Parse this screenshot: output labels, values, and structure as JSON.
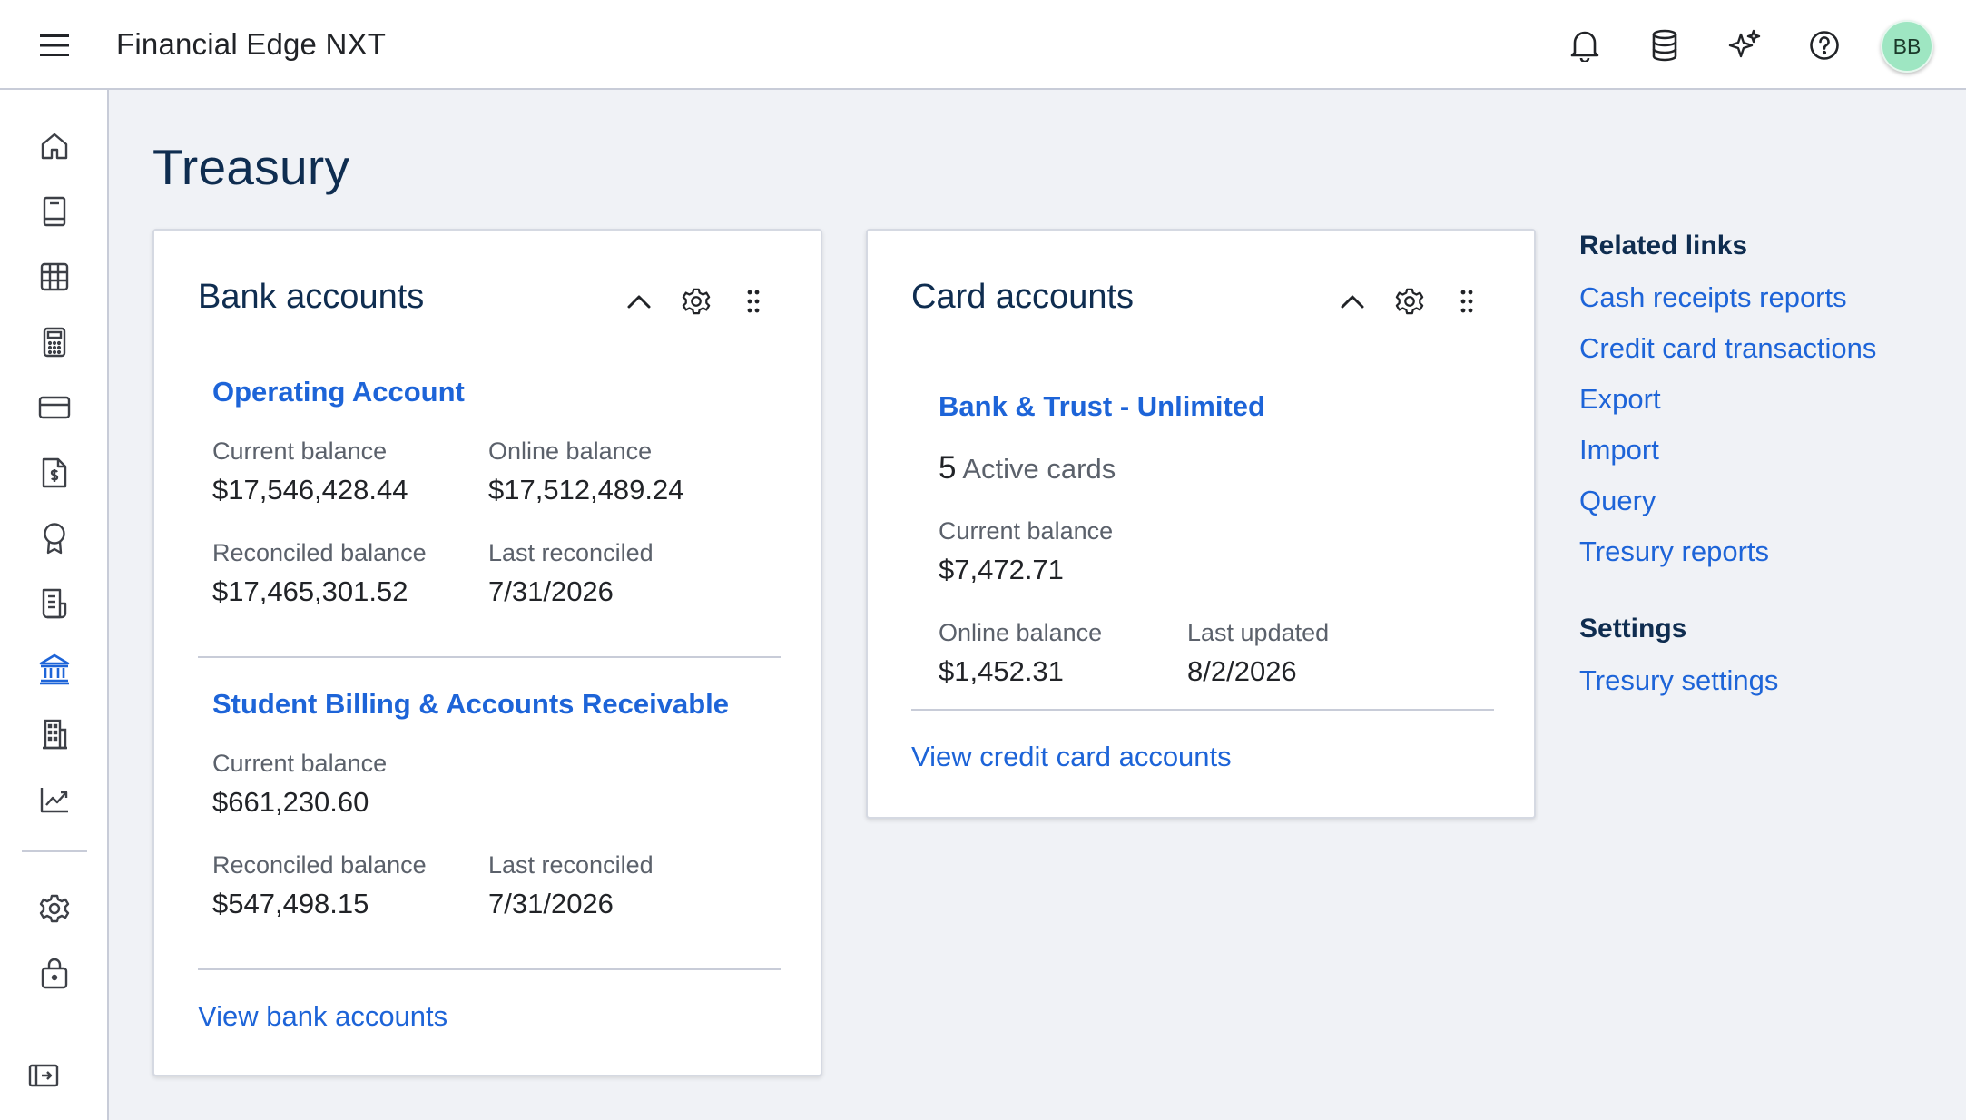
{
  "header": {
    "app_title": "Financial Edge NXT",
    "avatar_initials": "BB",
    "avatar_color": "#9ee6c2",
    "icons": [
      "hamburger-menu-icon",
      "bell-icon",
      "database-icon",
      "sparkle-icon",
      "help-icon"
    ]
  },
  "sidenav": {
    "items": [
      "home-icon",
      "book-icon",
      "grid-table-icon",
      "calculator-icon",
      "credit-card-icon",
      "document-dollar-icon",
      "award-ribbon-icon",
      "receipt-icon",
      "bank-icon",
      "building-icon",
      "trend-chart-icon",
      "gear-icon",
      "lock-briefcase-icon",
      "collapse-panel-icon"
    ],
    "active": "bank-icon"
  },
  "page": {
    "title": "Treasury"
  },
  "bank_accounts": {
    "title": "Bank accounts",
    "accounts": [
      {
        "name": "Operating Account",
        "current_balance_label": "Current balance",
        "current_balance": "$17,546,428.44",
        "online_balance_label": "Online balance",
        "online_balance": "$17,512,489.24",
        "reconciled_balance_label": "Reconciled balance",
        "reconciled_balance": "$17,465,301.52",
        "last_reconciled_label": "Last reconciled",
        "last_reconciled": "7/31/2026"
      },
      {
        "name": "Student Billing & Accounts Receivable",
        "current_balance_label": "Current balance",
        "current_balance": "$661,230.60",
        "reconciled_balance_label": "Reconciled balance",
        "reconciled_balance": "$547,498.15",
        "last_reconciled_label": "Last reconciled",
        "last_reconciled": "7/31/2026"
      }
    ],
    "view_link": "View bank accounts"
  },
  "card_accounts": {
    "title": "Card accounts",
    "account": {
      "name": "Bank & Trust - Unlimited",
      "active_count": "5",
      "active_label": "Active cards",
      "current_balance_label": "Current balance",
      "current_balance": "$7,472.71",
      "online_balance_label": "Online balance",
      "online_balance": "$1,452.31",
      "last_updated_label": "Last updated",
      "last_updated": "8/2/2026"
    },
    "view_link": "View credit card accounts"
  },
  "related_links": {
    "heading": "Related links",
    "links": [
      "Cash receipts reports",
      "Credit card transactions",
      "Export",
      "Import",
      "Query",
      "Tresury reports"
    ]
  },
  "settings": {
    "heading": "Settings",
    "links": [
      "Tresury settings"
    ]
  },
  "colors": {
    "link": "#1d64d8",
    "heading": "#0f2d50",
    "background": "#f0f2f6",
    "active_nav": "#1d64d8"
  }
}
